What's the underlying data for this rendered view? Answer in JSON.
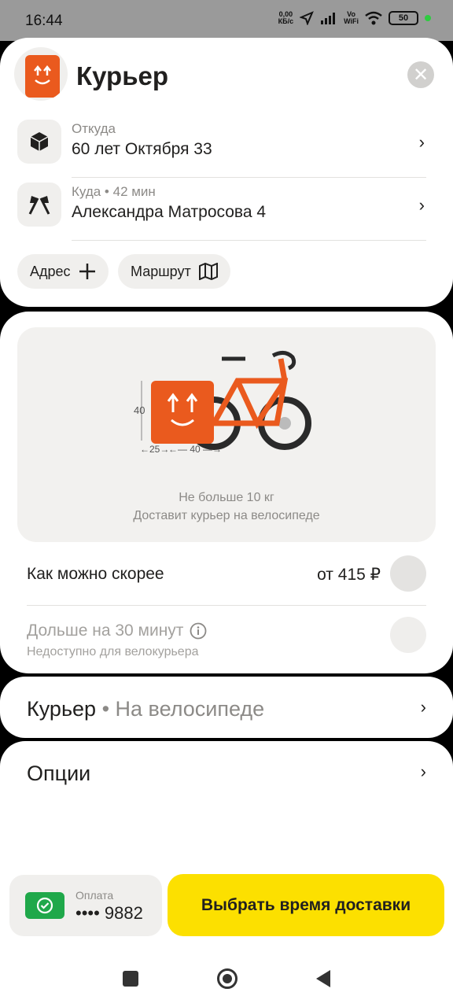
{
  "status_bar": {
    "time": "16:44",
    "net_speed_top": "0,00",
    "net_speed_bottom": "КБ/с",
    "vowifi_top": "Vo",
    "vowifi_bottom": "WiFi",
    "battery": "50"
  },
  "header": {
    "title": "Курьер"
  },
  "from": {
    "label": "Откуда",
    "value": "60 лет Октября 33"
  },
  "to": {
    "label": "Куда • 42 мин",
    "value": "Александра Матросова 4"
  },
  "chips": {
    "address": "Адрес",
    "route": "Маршрут"
  },
  "illustration": {
    "height_label": "40",
    "depth_label": "←25→",
    "width_label": "←— 40 —→",
    "weight_text": "Не больше 10 кг",
    "delivery_text": "Доставит курьер на велосипеде"
  },
  "tariffs": {
    "asap": {
      "title": "Как можно скорее",
      "price": "от 415 ₽"
    },
    "later": {
      "title": "Дольше на 30 минут",
      "subtitle": "Недоступно для велокурьера"
    }
  },
  "courier_row": {
    "title": "Курьер",
    "subtitle": "• На велосипеде"
  },
  "options_row": {
    "title": "Опции"
  },
  "payment": {
    "label": "Оплата",
    "value": "•••• 9882"
  },
  "cta": {
    "label": "Выбрать время доставки"
  },
  "colors": {
    "accent_yellow": "#fce000",
    "brand_orange": "#ea5a1e",
    "payment_green": "#1fa84a"
  }
}
